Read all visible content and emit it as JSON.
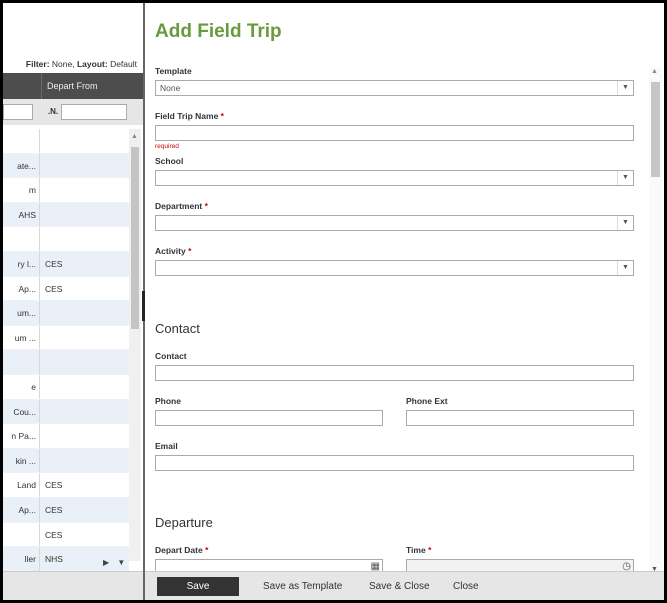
{
  "grid": {
    "filter_label": "Filter:",
    "filter_value": "None",
    "layout_label": "Layout:",
    "layout_value": "Default",
    "column_header": "Depart From",
    "filter_n_button": ".N.",
    "rows": [
      {
        "c1": "",
        "c2": ""
      },
      {
        "c1": "ate...",
        "c2": ""
      },
      {
        "c1": "m",
        "c2": ""
      },
      {
        "c1": "AHS",
        "c2": ""
      },
      {
        "c1": "",
        "c2": ""
      },
      {
        "c1": "ry l...",
        "c2": "CES"
      },
      {
        "c1": "Ap...",
        "c2": "CES"
      },
      {
        "c1": "um...",
        "c2": ""
      },
      {
        "c1": "um ...",
        "c2": ""
      },
      {
        "c1": "",
        "c2": ""
      },
      {
        "c1": "e",
        "c2": ""
      },
      {
        "c1": "Cou...",
        "c2": ""
      },
      {
        "c1": "n Pa...",
        "c2": ""
      },
      {
        "c1": "kin ...",
        "c2": ""
      },
      {
        "c1": "Land",
        "c2": "CES"
      },
      {
        "c1": "Ap...",
        "c2": "CES"
      },
      {
        "c1": "",
        "c2": "CES"
      },
      {
        "c1": "ller",
        "c2": "NHS"
      }
    ],
    "scroll_up": "▲",
    "scroll_right": "▶",
    "scroll_down": "▼"
  },
  "form": {
    "title": "Add Field Trip",
    "template_label": "Template",
    "template_value": "None",
    "field_trip_name_label": "Field Trip Name",
    "required_star": "*",
    "required_hint": "required",
    "school_label": "School",
    "department_label": "Department",
    "activity_label": "Activity",
    "contact_section": "Contact",
    "contact_label": "Contact",
    "phone_label": "Phone",
    "phone_ext_label": "Phone Ext",
    "email_label": "Email",
    "departure_section": "Departure",
    "depart_date_label": "Depart Date",
    "time_label": "Time",
    "dropdown_arrow": "▼",
    "scroll_up": "▲",
    "scroll_down": "▼",
    "calendar_glyph": "▦",
    "clock_glyph": "◷"
  },
  "actions": {
    "save": "Save",
    "save_as_template": "Save as Template",
    "save_close": "Save & Close",
    "close": "Close"
  }
}
